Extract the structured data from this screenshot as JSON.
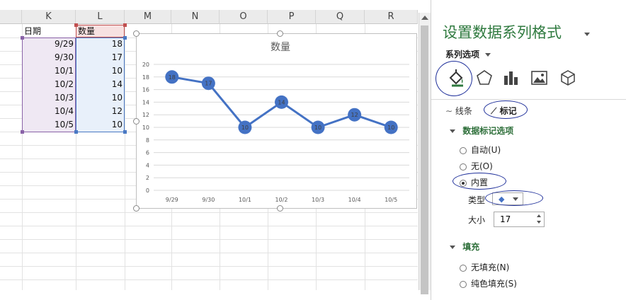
{
  "columns": [
    "K",
    "L",
    "M",
    "N",
    "O",
    "P",
    "Q",
    "R"
  ],
  "table": {
    "header": {
      "k": "日期",
      "l": "数量"
    },
    "rows": [
      {
        "date": "9/29",
        "qty": "18"
      },
      {
        "date": "9/30",
        "qty": "17"
      },
      {
        "date": "10/1",
        "qty": "10"
      },
      {
        "date": "10/2",
        "qty": "14"
      },
      {
        "date": "10/3",
        "qty": "10"
      },
      {
        "date": "10/4",
        "qty": "12"
      },
      {
        "date": "10/5",
        "qty": "10"
      }
    ]
  },
  "chart_data": {
    "type": "line",
    "title": "数量",
    "categories": [
      "9/29",
      "9/30",
      "10/1",
      "10/2",
      "10/3",
      "10/4",
      "10/5"
    ],
    "values": [
      18,
      17,
      10,
      14,
      10,
      12,
      10
    ],
    "ylim": [
      0,
      20
    ],
    "yticks": [
      "0",
      "2",
      "4",
      "6",
      "8",
      "10",
      "12",
      "14",
      "16",
      "18",
      "20"
    ],
    "grid": true,
    "data_labels": "inside markers",
    "line_color": "#4472c4"
  },
  "pane": {
    "title": "设置数据系列格式",
    "series_options": "系列选项",
    "tabs": {
      "line": "线条",
      "marker": "标记"
    },
    "marker_options": "数据标记选项",
    "auto": "自动(U)",
    "none": "无(O)",
    "builtin": "内置",
    "type_label": "类型",
    "size_label": "大小",
    "size_value": "17",
    "fill_section": "填充",
    "no_fill": "无填充(N)",
    "solid_fill": "纯色填充(S)",
    "accent": "#2f7a3f",
    "highlight": "#1e2f9a"
  }
}
